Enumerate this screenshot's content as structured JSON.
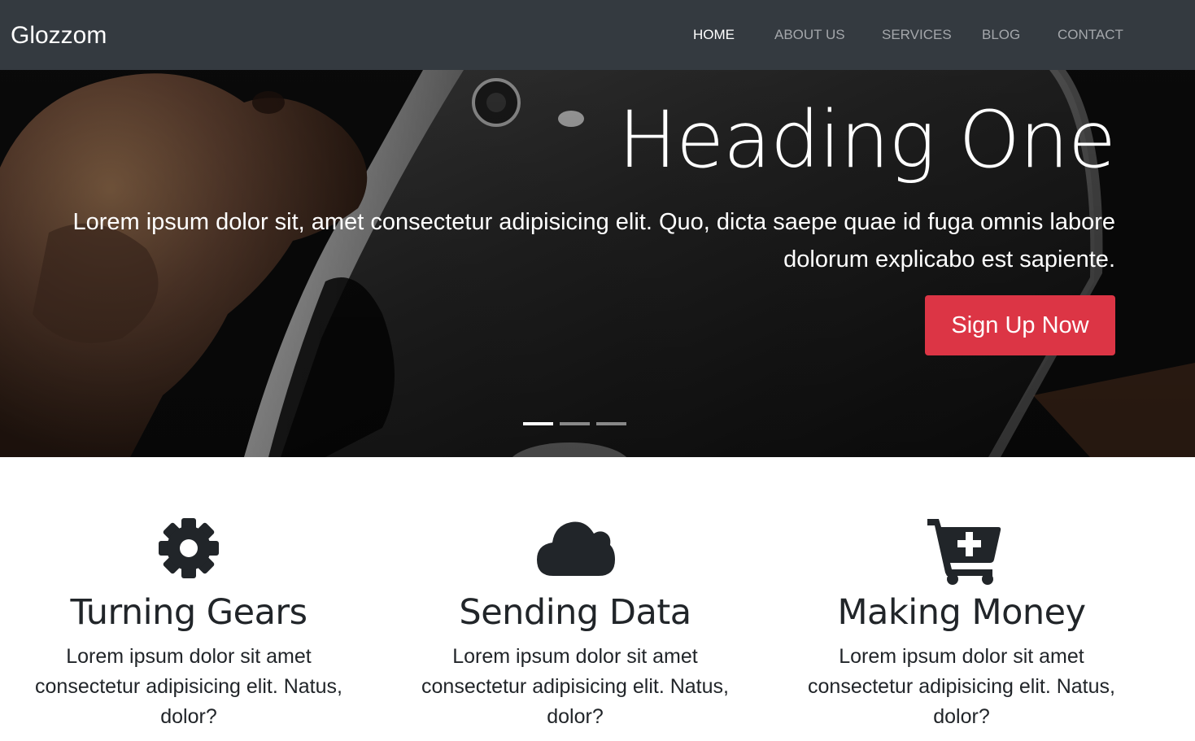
{
  "navbar": {
    "brand": "Glozzom",
    "links": [
      {
        "label": "HOME",
        "active": true
      },
      {
        "label": "ABOUT US",
        "active": false
      },
      {
        "label": "SERVICES",
        "active": false
      },
      {
        "label": "BLOG",
        "active": false
      },
      {
        "label": "CONTACT",
        "active": false
      }
    ]
  },
  "hero": {
    "heading": "Heading One",
    "text": "Lorem ipsum dolor sit, amet consectetur adipisicing elit. Quo, dicta saepe quae id fuga omnis labore dolorum explicabo est sapiente.",
    "button_label": "Sign Up Now",
    "button_color": "#dc3545",
    "slide_count": 3,
    "active_slide": 1
  },
  "features": [
    {
      "icon": "gear-icon",
      "title": "Turning Gears",
      "text": "Lorem ipsum dolor sit amet consectetur adipisicing elit. Natus, dolor?"
    },
    {
      "icon": "cloud-icon",
      "title": "Sending Data",
      "text": "Lorem ipsum dolor sit amet consectetur adipisicing elit. Natus, dolor?"
    },
    {
      "icon": "cart-plus-icon",
      "title": "Making Money",
      "text": "Lorem ipsum dolor sit amet consectetur adipisicing elit. Natus, dolor?"
    }
  ],
  "colors": {
    "navbar_bg": "#343a40",
    "nav_active": "#ffffff",
    "nav_inactive": "#a4a7ab",
    "accent": "#dc3545",
    "text_dark": "#212529"
  }
}
